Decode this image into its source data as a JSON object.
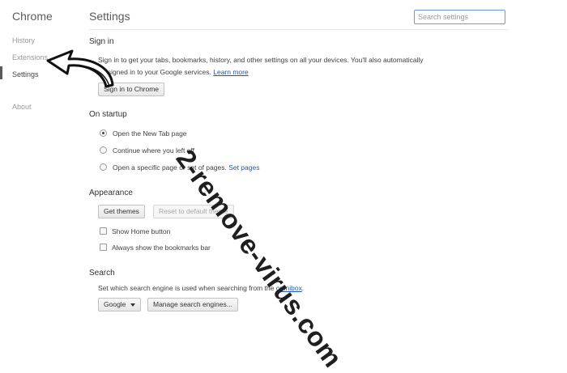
{
  "sidebar": {
    "brand": "Chrome",
    "items": [
      {
        "label": "History"
      },
      {
        "label": "Extensions"
      },
      {
        "label": "Settings"
      },
      {
        "label": "About"
      }
    ]
  },
  "header": {
    "title": "Settings",
    "search_placeholder": "Search settings"
  },
  "signin": {
    "title": "Sign in",
    "line1": "Sign in to get your tabs, bookmarks, history, and other settings on all your devices. You'll also automatically",
    "line2": "be signed in to your Google services.",
    "learn_more": "Learn more",
    "button": "Sign in to Chrome"
  },
  "startup": {
    "title": "On startup",
    "options": [
      {
        "label": "Open the New Tab page",
        "selected": true
      },
      {
        "label": "Continue where you left off",
        "selected": false
      },
      {
        "label": "Open a specific page or set of pages.",
        "selected": false
      }
    ],
    "set_pages": "Set pages"
  },
  "appearance": {
    "title": "Appearance",
    "get_themes": "Get themes",
    "reset_theme": "Reset to default theme",
    "show_home": "Show Home button",
    "show_bookmarks": "Always show the bookmarks bar"
  },
  "search": {
    "title": "Search",
    "desc": "Set which search engine is used when searching from the",
    "omnibox": "omnibox",
    "period": ".",
    "engine": "Google",
    "manage": "Manage search engines..."
  },
  "watermark": "2-remove-virus.com",
  "colors": {
    "accent": "#1f5aa8",
    "focus": "#6b9ec6"
  }
}
